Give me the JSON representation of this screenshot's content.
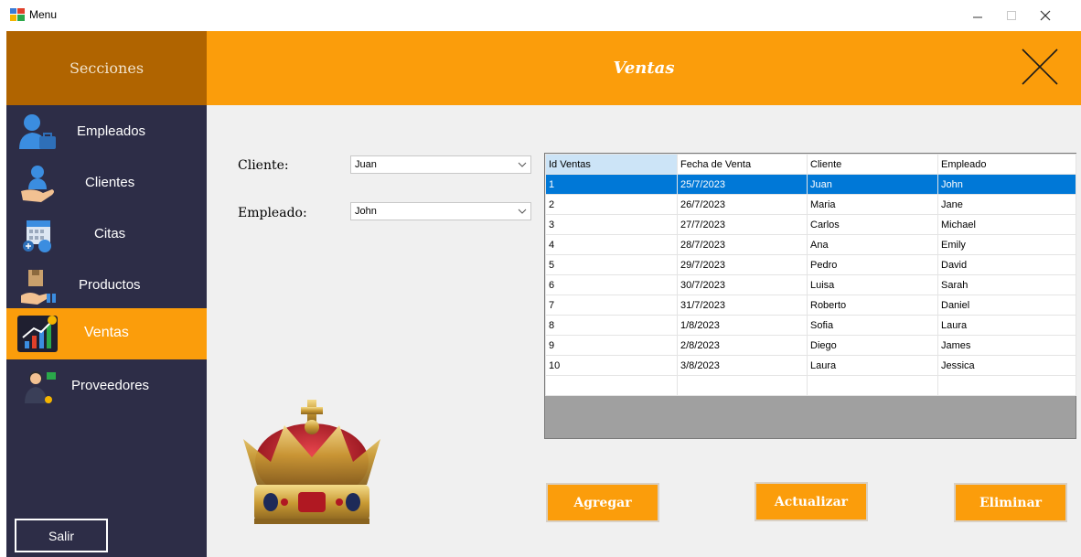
{
  "window": {
    "title": "Menu",
    "icon": "app-window-icon",
    "controls": [
      "minimize",
      "maximize",
      "close"
    ]
  },
  "sidebar": {
    "header": "Secciones",
    "items": [
      {
        "label": "Empleados",
        "icon": "employees-icon",
        "active": false
      },
      {
        "label": "Clientes",
        "icon": "clients-icon",
        "active": false
      },
      {
        "label": "Citas",
        "icon": "calendar-icon",
        "active": false
      },
      {
        "label": "Productos",
        "icon": "products-icon",
        "active": false
      },
      {
        "label": "Ventas",
        "icon": "sales-chart-icon",
        "active": true
      },
      {
        "label": "Proveedores",
        "icon": "suppliers-icon",
        "active": false
      }
    ],
    "exit_label": "Salir"
  },
  "header": {
    "title": "Ventas"
  },
  "form": {
    "cliente_label": "Cliente:",
    "cliente_value": "Juan",
    "empleado_label": "Empleado:",
    "empleado_value": "John"
  },
  "grid": {
    "columns": [
      "Id Ventas",
      "Fecha de Venta",
      "Cliente",
      "Empleado"
    ],
    "rows": [
      [
        "1",
        "25/7/2023",
        "Juan",
        "John"
      ],
      [
        "2",
        "26/7/2023",
        "Maria",
        "Jane"
      ],
      [
        "3",
        "27/7/2023",
        "Carlos",
        "Michael"
      ],
      [
        "4",
        "28/7/2023",
        "Ana",
        "Emily"
      ],
      [
        "5",
        "29/7/2023",
        "Pedro",
        "David"
      ],
      [
        "6",
        "30/7/2023",
        "Luisa",
        "Sarah"
      ],
      [
        "7",
        "31/7/2023",
        "Roberto",
        "Daniel"
      ],
      [
        "8",
        "1/8/2023",
        "Sofia",
        "Laura"
      ],
      [
        "9",
        "2/8/2023",
        "Diego",
        "James"
      ],
      [
        "10",
        "3/8/2023",
        "Laura",
        "Jessica"
      ]
    ],
    "selected_row": 0
  },
  "actions": {
    "add": "Agregar",
    "update": "Actualizar",
    "delete": "Eliminar"
  },
  "colors": {
    "accent": "#fb9d0b",
    "sidebar_bg": "#2d2d47",
    "sidebar_header": "#b06400",
    "selection": "#0078d7"
  }
}
